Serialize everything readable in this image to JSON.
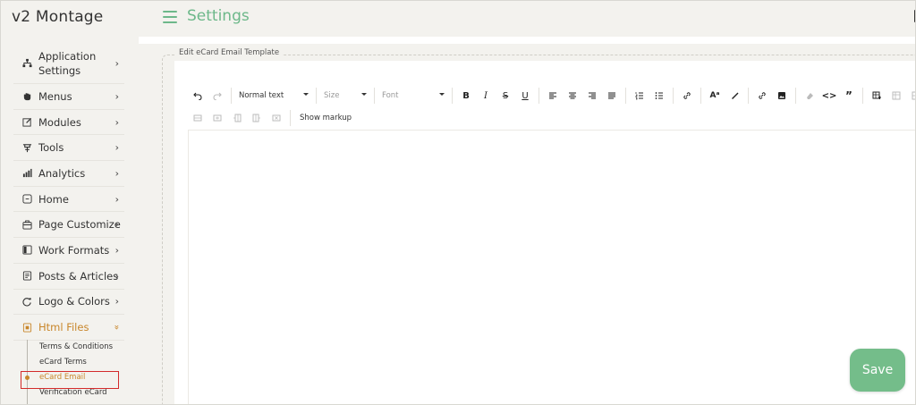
{
  "app": {
    "title": "v2 Montage"
  },
  "header": {
    "title": "Settings"
  },
  "sidebar": {
    "items": [
      {
        "label": "Application\nSettings",
        "icon": "sitemap-icon"
      },
      {
        "label": "Menus",
        "icon": "hand-icon"
      },
      {
        "label": "Modules",
        "icon": "edit-icon"
      },
      {
        "label": "Tools",
        "icon": "tools-icon"
      },
      {
        "label": "Analytics",
        "icon": "bar-chart-icon"
      },
      {
        "label": "Home",
        "icon": "home-icon"
      },
      {
        "label": "Page Customize",
        "icon": "page-customize-icon"
      },
      {
        "label": "Work Formats",
        "icon": "work-formats-icon"
      },
      {
        "label": "Posts & Articles",
        "icon": "posts-icon"
      },
      {
        "label": "Logo & Colors",
        "icon": "logo-icon"
      },
      {
        "label": "Html Files",
        "icon": "html-file-icon"
      }
    ],
    "chevron": "›",
    "expanded_chevron": "»",
    "sub_items": [
      {
        "label": "Terms & Conditions"
      },
      {
        "label": "eCard Terms"
      },
      {
        "label": "eCard Email",
        "active": true
      },
      {
        "label": "Verification eCard"
      }
    ]
  },
  "editor": {
    "legend": "Edit eCard Email Template",
    "block_select": "Normal text",
    "size_select": "Size",
    "font_select": "Font",
    "show_markup": "Show markup",
    "content": ""
  },
  "actions": {
    "save": "Save"
  },
  "colors": {
    "accent_green": "#6db88a",
    "accent_orange": "#c8862a",
    "save_bg": "#74bd8a",
    "highlight": "#d32b2b"
  }
}
